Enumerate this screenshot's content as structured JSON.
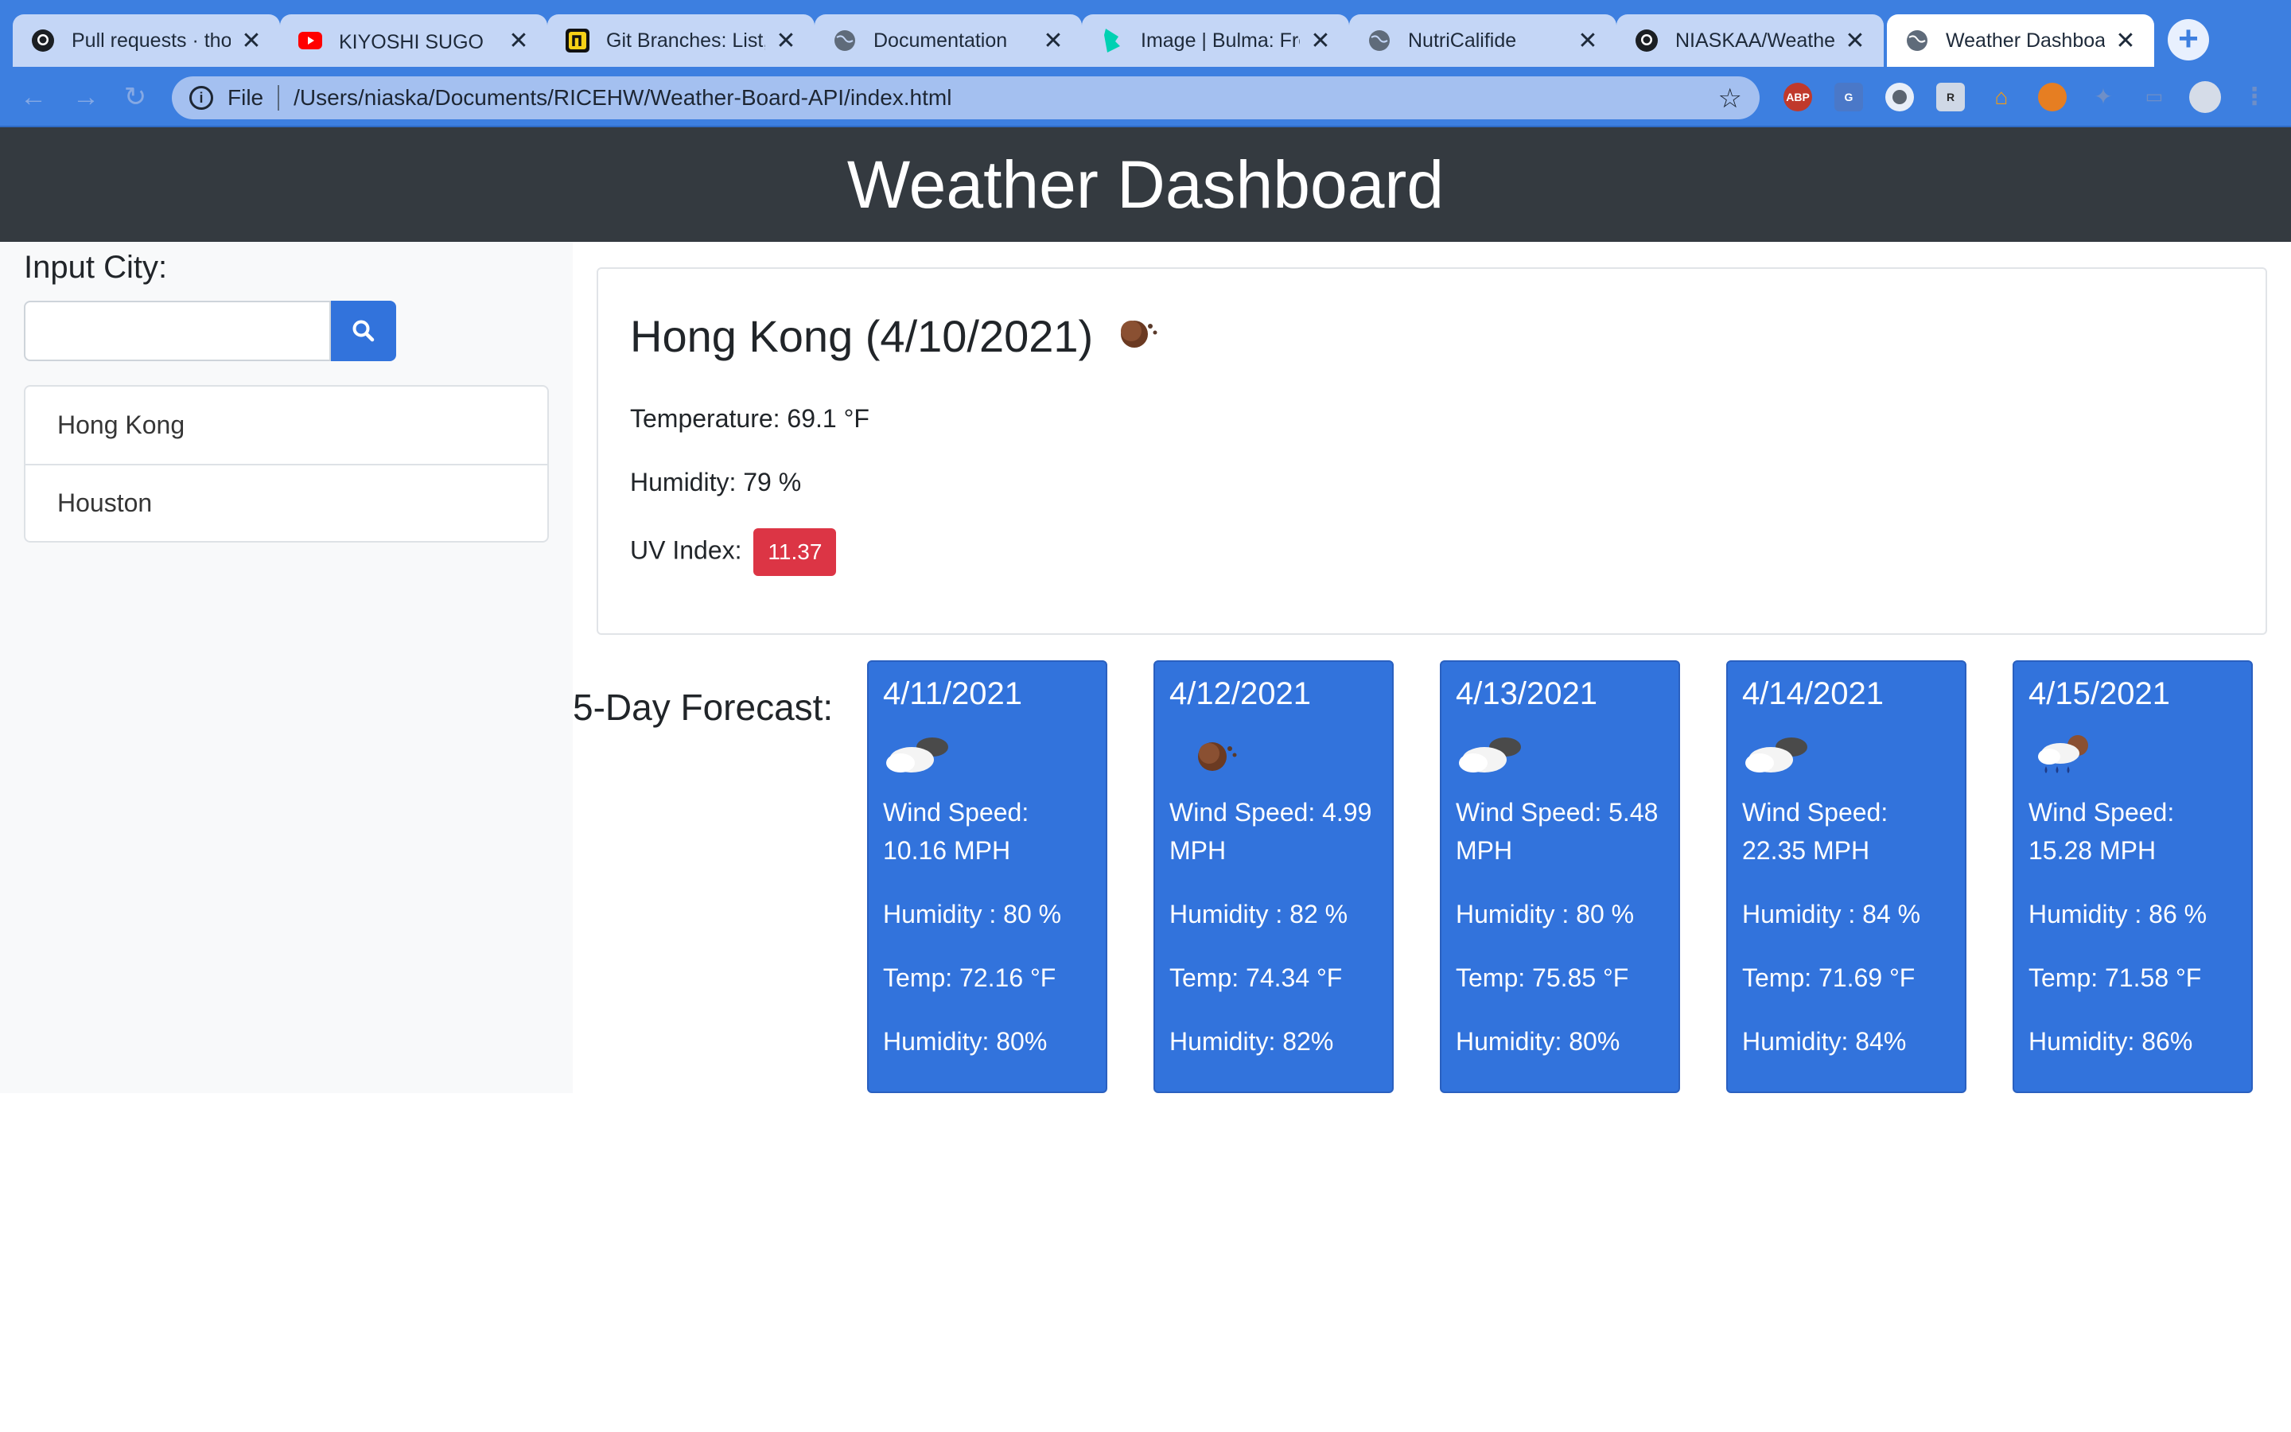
{
  "browser": {
    "tabs": [
      {
        "title": "Pull requests · tho",
        "favicon": "github-icon"
      },
      {
        "title": "KIYOSHI SUGO 「/",
        "favicon": "youtube-icon"
      },
      {
        "title": "Git Branches: List,",
        "favicon": "n-logo-icon"
      },
      {
        "title": "Documentation",
        "favicon": "globe-icon"
      },
      {
        "title": "Image | Bulma: Fre",
        "favicon": "bulma-icon"
      },
      {
        "title": "NutriCalifide",
        "favicon": "globe-icon"
      },
      {
        "title": "NIASKAA/Weather",
        "favicon": "github-icon"
      },
      {
        "title": "Weather Dashboa",
        "favicon": "globe-icon",
        "active": true
      }
    ],
    "close_glyph": "✕",
    "new_tab_glyph": "+",
    "address": {
      "scheme_label": "File",
      "url": "/Users/niaska/Documents/RICEHW/Weather-Board-API/index.html"
    },
    "extensions": [
      "ABP"
    ]
  },
  "page": {
    "title": "Weather Dashboard",
    "sidebar": {
      "input_label": "Input City:",
      "search_value": "",
      "cities": [
        "Hong Kong",
        "Houston"
      ]
    },
    "current": {
      "heading": "Hong Kong (4/10/2021)",
      "icon": "moon-icon",
      "temperature": "Temperature: 69.1 °F",
      "humidity": "Humidity: 79 %",
      "uv_label": "UV Index:",
      "uv_value": "11.37",
      "uv_color": "#dc3545"
    },
    "forecast_label": "5-Day Forecast:",
    "forecast": [
      {
        "date": "4/11/2021",
        "icon": "cloud-icon",
        "wind": "Wind Speed: 10.16 MPH",
        "humidity1": "Humidity : 80 %",
        "temp": "Temp: 72.16 °F",
        "humidity2": "Humidity: 80%"
      },
      {
        "date": "4/12/2021",
        "icon": "moon-icon",
        "wind": "Wind Speed: 4.99 MPH",
        "humidity1": "Humidity : 82 %",
        "temp": "Temp: 74.34 °F",
        "humidity2": "Humidity: 82%"
      },
      {
        "date": "4/13/2021",
        "icon": "cloud-icon",
        "wind": "Wind Speed: 5.48 MPH",
        "humidity1": "Humidity : 80 %",
        "temp": "Temp: 75.85 °F",
        "humidity2": "Humidity: 80%"
      },
      {
        "date": "4/14/2021",
        "icon": "cloud-icon",
        "wind": "Wind Speed: 22.35 MPH",
        "humidity1": "Humidity : 84 %",
        "temp": "Temp: 71.69 °F",
        "humidity2": "Humidity: 84%"
      },
      {
        "date": "4/15/2021",
        "icon": "rain-cloud-icon",
        "wind": "Wind Speed: 15.28 MPH",
        "humidity1": "Humidity : 86 %",
        "temp": "Temp: 71.58 °F",
        "humidity2": "Humidity: 86%"
      }
    ],
    "colors": {
      "header": "#343a40",
      "accent": "#3273dc",
      "uv_badge": "#dc3545"
    }
  }
}
